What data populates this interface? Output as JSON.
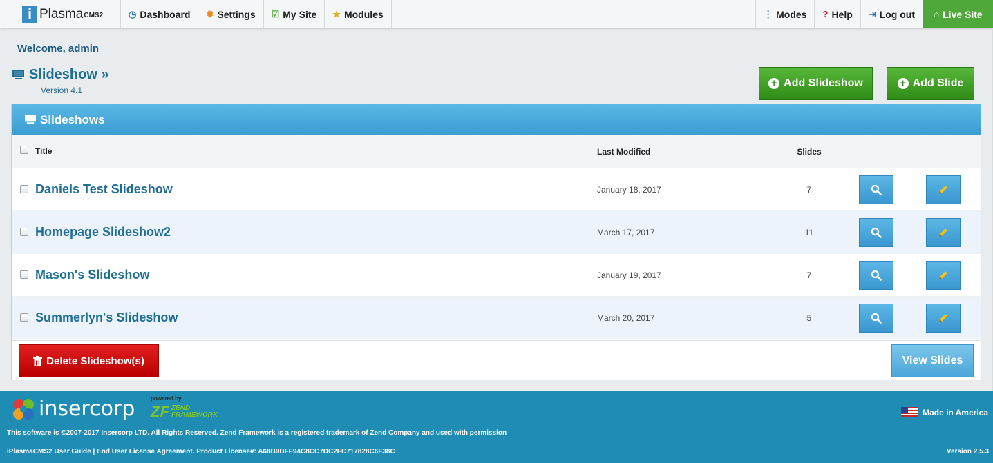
{
  "brand": {
    "icon_letter": "i",
    "name": "Plasma",
    "suffix": "CMS2"
  },
  "nav_left": [
    {
      "label": "Dashboard",
      "icon": "dashboard-icon",
      "glyph": "◷",
      "color": "#2a7ab0"
    },
    {
      "label": "Settings",
      "icon": "gear-icon",
      "glyph": "✹",
      "color": "#e8871e"
    },
    {
      "label": "My Site",
      "icon": "check-square-icon",
      "glyph": "☑",
      "color": "#4ea83a"
    },
    {
      "label": "Modules",
      "icon": "star-icon",
      "glyph": "★",
      "color": "#e0b020"
    }
  ],
  "nav_right": [
    {
      "label": "Modes",
      "icon": "vertical-dots-icon",
      "glyph": "⋮",
      "color": "#2a7ab0"
    },
    {
      "label": "Help",
      "icon": "question-circle-icon",
      "glyph": "?",
      "color": "#d41919"
    },
    {
      "label": "Log out",
      "icon": "logout-icon",
      "glyph": "⇥",
      "color": "#2a7ab0"
    },
    {
      "label": "Live Site",
      "icon": "home-icon",
      "glyph": "⌂",
      "color": "#ffffff"
    }
  ],
  "welcome": "Welcome, admin",
  "page": {
    "title": "Slideshow »",
    "version": "Version 4.1"
  },
  "actions": {
    "add_slideshow": "Add Slideshow",
    "add_slide": "Add Slide"
  },
  "panel": {
    "title": "Slideshows",
    "columns": {
      "title": "Title",
      "modified": "Last Modified",
      "slides": "Slides"
    },
    "rows": [
      {
        "title": "Daniels Test Slideshow",
        "modified": "January 18, 2017",
        "slides": "7"
      },
      {
        "title": "Homepage Slideshow2",
        "modified": "March 17, 2017",
        "slides": "11"
      },
      {
        "title": "Mason's Slideshow",
        "modified": "January 19, 2017",
        "slides": "7"
      },
      {
        "title": "Summerlyn's Slideshow",
        "modified": "March 20, 2017",
        "slides": "5"
      }
    ],
    "delete_label": "Delete Slideshow(s)",
    "view_label": "View Slides"
  },
  "footer": {
    "company": "insercorp",
    "powered_by": "powered by",
    "zend_logo": "ZF",
    "zend_line1": "ZEND",
    "zend_line2": "FRAMEWORK",
    "made_in": "Made in America",
    "copyright": "This software is ©2007-2017 Insercorp LTD. All Rights Reserved. Zend Framework is a registered trademark of Zend Company and used with permission",
    "license": "iPlasmaCMS2 User Guide | End User License Agreement. Product License#: A68B9BFF94C8CC7DC2FC717828C6F38C",
    "version": "Version 2.5.3"
  },
  "colors": {
    "accent": "#1f6f95",
    "green": "#3a9a22",
    "blue": "#3a9cd2",
    "red": "#cc0000",
    "footer": "#1f8cb3"
  }
}
